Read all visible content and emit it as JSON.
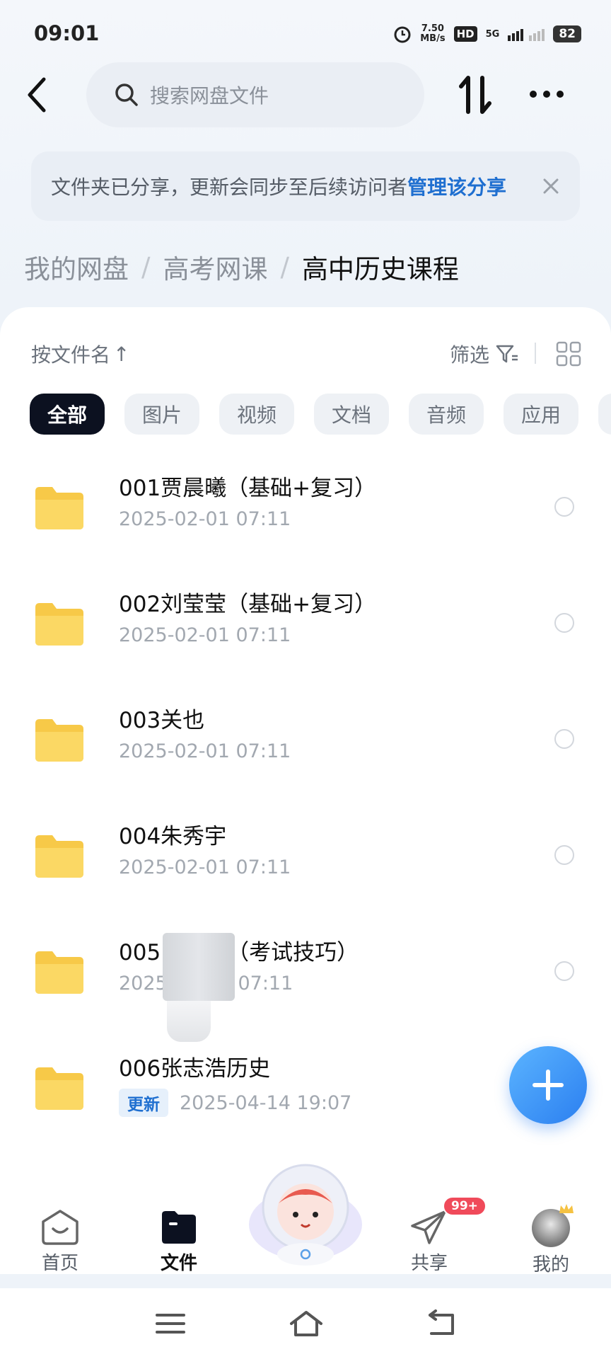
{
  "status_bar": {
    "time": "09:01",
    "speed_value": "7.50",
    "speed_unit": "MB/s",
    "hd": "HD",
    "network": "5G",
    "battery": "82"
  },
  "header": {
    "search_placeholder": "搜索网盘文件"
  },
  "share_banner": {
    "text": "文件夹已分享，更新会同步至后续访问者",
    "link": "管理该分享"
  },
  "breadcrumb": {
    "items": [
      "我的网盘",
      "高考网课"
    ],
    "current": "高中历史课程",
    "separator": "/"
  },
  "toolbar": {
    "sort_label": "按文件名",
    "sort_arrow": "↑",
    "filter_label": "筛选"
  },
  "categories": [
    "全部",
    "图片",
    "视频",
    "文档",
    "音频",
    "应用"
  ],
  "files": [
    {
      "name": "001贾晨曦（基础+复习）",
      "date": "2025-02-01  07:11",
      "badge": ""
    },
    {
      "name": "002刘莹莹（基础+复习）",
      "date": "2025-02-01  07:11",
      "badge": ""
    },
    {
      "name": "003关也",
      "date": "2025-02-01  07:11",
      "badge": ""
    },
    {
      "name": "004朱秀宇",
      "date": "2025-02-01  07:11",
      "badge": ""
    },
    {
      "name": "005",
      "name_suffix": "（考试技巧）",
      "date_prefix": "2025-",
      "date_suffix": "07:11",
      "badge": ""
    },
    {
      "name": "006张志浩历史",
      "date": "2025-04-14  19:07",
      "badge": "更新"
    }
  ],
  "nav": {
    "home": "首页",
    "files": "文件",
    "share": "共享",
    "share_badge": "99+",
    "mine": "我的"
  },
  "colors": {
    "accent": "#1f6fd0",
    "folder": "#f7c948",
    "badge_red": "#f04a5a"
  }
}
